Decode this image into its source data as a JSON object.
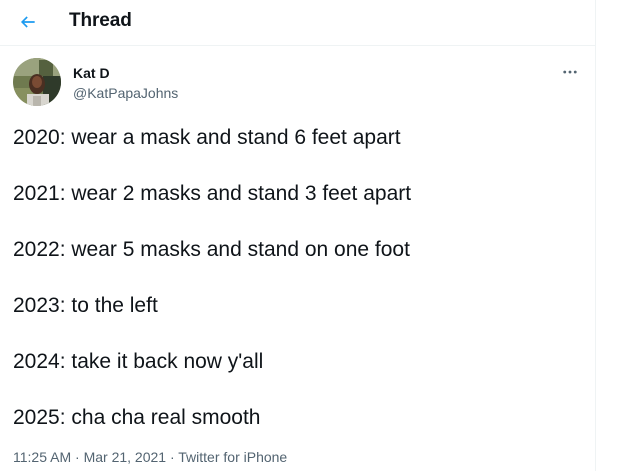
{
  "header": {
    "title": "Thread"
  },
  "author": {
    "name": "Kat D",
    "handle": "@KatPapaJohns"
  },
  "tweet": {
    "lines": [
      "2020: wear a mask and stand 6 feet apart",
      "2021: wear 2 masks and stand 3 feet apart",
      "2022: wear 5 masks and stand on one foot",
      "2023: to the left",
      "2024: take it back now y'all",
      "2025: cha cha real smooth"
    ]
  },
  "meta": {
    "time": "11:25 AM",
    "separator": " · ",
    "date": "Mar 21, 2021",
    "source": "Twitter for iPhone"
  },
  "icons": {
    "back": "arrow-left-icon",
    "more": "more-horizontal-icon"
  },
  "colors": {
    "accent": "#1d9bf0",
    "text": "#0f1419",
    "secondary": "#536471",
    "border": "#eff3f4"
  }
}
